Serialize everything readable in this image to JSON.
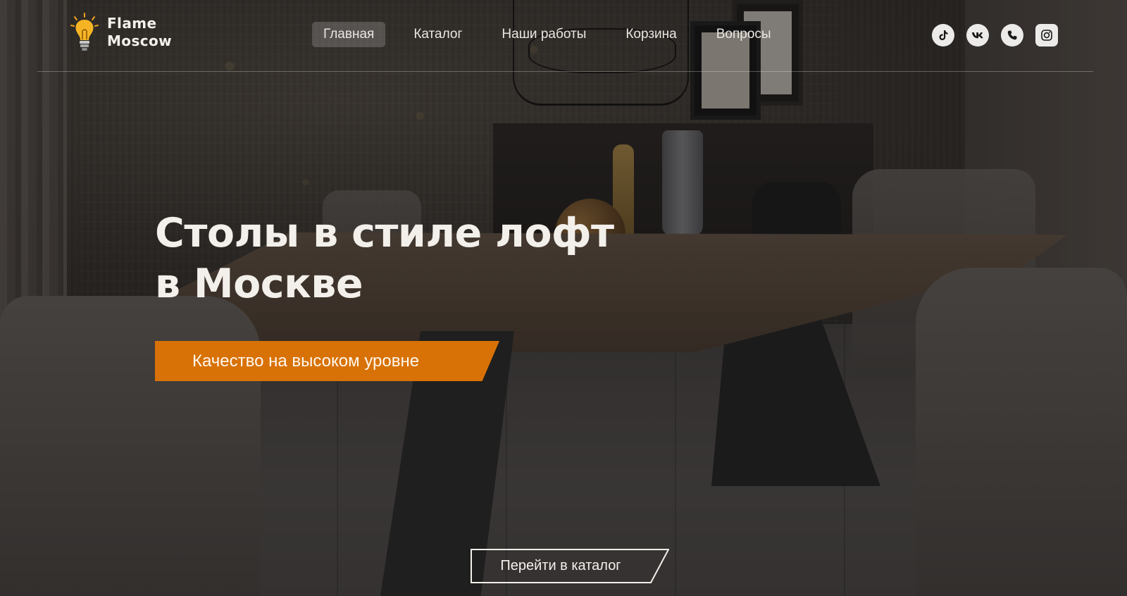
{
  "brand": {
    "line1": "Flame",
    "line2": "Moscow"
  },
  "nav": {
    "items": [
      {
        "label": "Главная",
        "active": true
      },
      {
        "label": "Каталог",
        "active": false
      },
      {
        "label": "Наши работы",
        "active": false
      },
      {
        "label": "Корзина",
        "active": false
      },
      {
        "label": "Вопросы",
        "active": false
      }
    ]
  },
  "socials": [
    {
      "icon": "tiktok-icon"
    },
    {
      "icon": "vk-icon"
    },
    {
      "icon": "whatsapp-icon"
    },
    {
      "icon": "instagram-icon"
    }
  ],
  "hero": {
    "title_line1": "Столы в стиле лофт",
    "title_line2": "в Москве",
    "tagline": "Качество на высоком уровне",
    "cta_label": "Перейти в каталог"
  },
  "colors": {
    "accent": "#d87206",
    "text": "#f3f0eb",
    "overlay": "#141211"
  }
}
